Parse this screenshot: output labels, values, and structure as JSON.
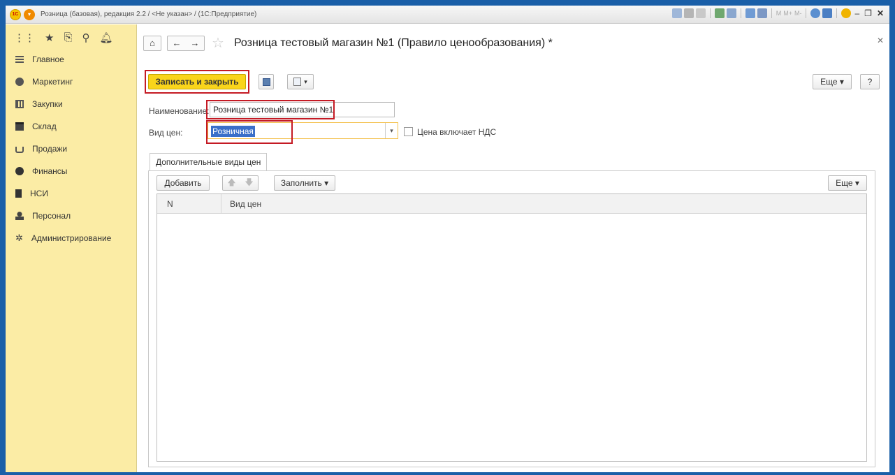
{
  "titlebar": {
    "logo": "1С",
    "title": "Розница (базовая), редакция 2.2 / <Не указан> / (1С:Предприятие)",
    "memory_labels": [
      "M",
      "M+",
      "M-"
    ]
  },
  "sidebar": {
    "items": [
      {
        "label": "Главное",
        "icon": "menu-lines-icon"
      },
      {
        "label": "Маркетинг",
        "icon": "marketing-icon"
      },
      {
        "label": "Закупки",
        "icon": "purchases-icon"
      },
      {
        "label": "Склад",
        "icon": "warehouse-icon"
      },
      {
        "label": "Продажи",
        "icon": "basket-icon"
      },
      {
        "label": "Финансы",
        "icon": "finance-icon"
      },
      {
        "label": "НСИ",
        "icon": "reference-icon"
      },
      {
        "label": "Персонал",
        "icon": "person-icon"
      },
      {
        "label": "Администрирование",
        "icon": "gear-icon"
      }
    ]
  },
  "form": {
    "title": "Розница тестовый магазин №1 (Правило ценообразования) *",
    "save_close_label": "Записать и закрыть",
    "more_label": "Еще ▾",
    "help_label": "?",
    "name_label": "Наименование:",
    "name_value": "Розница тестовый магазин №1",
    "price_type_label": "Вид цен:",
    "price_type_value": "Розничная",
    "vat_label": "Цена включает НДС",
    "tab_label": "Дополнительные виды цен",
    "add_label": "Добавить",
    "fill_label": "Заполнить ▾",
    "table_more_label": "Еще ▾",
    "columns": [
      "N",
      "Вид цен"
    ]
  },
  "colors": {
    "frame": "#1a5fa8",
    "sidebar_bg": "#fbeca5",
    "primary_button": "#f9d41b",
    "highlight_box": "#c41a24"
  }
}
